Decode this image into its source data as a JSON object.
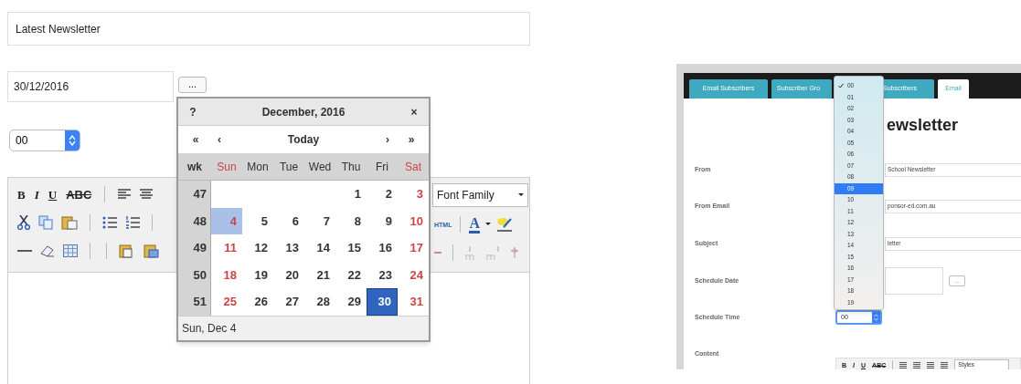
{
  "editor_form": {
    "title_field": {
      "value": "Latest Newsletter"
    },
    "date_field": {
      "value": "30/12/2016"
    },
    "date_button": "...",
    "time_select": {
      "value": "00"
    },
    "toolbar": {
      "format_buttons": [
        "B",
        "I",
        "U",
        "ABC"
      ],
      "font_family": "Font Family",
      "html_button": "HTML",
      "font_color_button": "A"
    }
  },
  "calendar": {
    "help": "?",
    "title": "December, 2016",
    "close": "×",
    "nav": [
      "«",
      "‹",
      "Today",
      "›",
      "»"
    ],
    "week_header": "wk",
    "weekdays": [
      {
        "label": "Sun",
        "weekend": true
      },
      {
        "label": "Mon",
        "weekend": false
      },
      {
        "label": "Tue",
        "weekend": false
      },
      {
        "label": "Wed",
        "weekend": false
      },
      {
        "label": "Thu",
        "weekend": false
      },
      {
        "label": "Fri",
        "weekend": false
      },
      {
        "label": "Sat",
        "weekend": true
      }
    ],
    "weeks": [
      {
        "number": "47",
        "days": [
          {
            "label": "1",
            "weekend": false,
            "selected": false,
            "hovered": false
          },
          {
            "label": "2",
            "weekend": false,
            "selected": false,
            "hovered": false
          },
          {
            "label": "3",
            "weekend": true,
            "selected": false,
            "hovered": false
          }
        ]
      },
      {
        "number": "48",
        "days": [
          {
            "label": "4",
            "weekend": true,
            "selected": false,
            "hovered": true
          },
          {
            "label": "5",
            "weekend": false,
            "selected": false,
            "hovered": false
          },
          {
            "label": "6",
            "weekend": false,
            "selected": false,
            "hovered": false
          },
          {
            "label": "7",
            "weekend": false,
            "selected": false,
            "hovered": false
          },
          {
            "label": "8",
            "weekend": false,
            "selected": false,
            "hovered": false
          },
          {
            "label": "9",
            "weekend": false,
            "selected": false,
            "hovered": false
          },
          {
            "label": "10",
            "weekend": true,
            "selected": false,
            "hovered": false
          }
        ]
      },
      {
        "number": "49",
        "days": [
          {
            "label": "11",
            "weekend": true,
            "selected": false,
            "hovered": false
          },
          {
            "label": "12",
            "weekend": false,
            "selected": false,
            "hovered": false
          },
          {
            "label": "13",
            "weekend": false,
            "selected": false,
            "hovered": false
          },
          {
            "label": "14",
            "weekend": false,
            "selected": false,
            "hovered": false
          },
          {
            "label": "15",
            "weekend": false,
            "selected": false,
            "hovered": false
          },
          {
            "label": "16",
            "weekend": false,
            "selected": false,
            "hovered": false
          },
          {
            "label": "17",
            "weekend": true,
            "selected": false,
            "hovered": false
          }
        ]
      },
      {
        "number": "50",
        "days": [
          {
            "label": "18",
            "weekend": true,
            "selected": false,
            "hovered": false
          },
          {
            "label": "19",
            "weekend": false,
            "selected": false,
            "hovered": false
          },
          {
            "label": "20",
            "weekend": false,
            "selected": false,
            "hovered": false
          },
          {
            "label": "21",
            "weekend": false,
            "selected": false,
            "hovered": false
          },
          {
            "label": "22",
            "weekend": false,
            "selected": false,
            "hovered": false
          },
          {
            "label": "23",
            "weekend": false,
            "selected": false,
            "hovered": false
          },
          {
            "label": "24",
            "weekend": true,
            "selected": false,
            "hovered": false
          }
        ]
      },
      {
        "number": "51",
        "days": [
          {
            "label": "25",
            "weekend": true,
            "selected": false,
            "hovered": false
          },
          {
            "label": "26",
            "weekend": false,
            "selected": false,
            "hovered": false
          },
          {
            "label": "27",
            "weekend": false,
            "selected": false,
            "hovered": false
          },
          {
            "label": "28",
            "weekend": false,
            "selected": false,
            "hovered": false
          },
          {
            "label": "29",
            "weekend": false,
            "selected": false,
            "hovered": false
          },
          {
            "label": "30",
            "weekend": false,
            "selected": true,
            "hovered": false
          },
          {
            "label": "31",
            "weekend": true,
            "selected": false,
            "hovered": false
          }
        ]
      }
    ],
    "status": "Sun, Dec 4"
  },
  "preview": {
    "tabs": [
      {
        "label": "Email Subscribers",
        "selected": false
      },
      {
        "label": "Subscriber Gro",
        "selected": false
      },
      {
        "label": "Subscribers",
        "selected": false
      },
      {
        "label": "Email",
        "selected": true
      }
    ],
    "heading": "ewsletter",
    "rows": [
      {
        "label": "From",
        "kind": "text",
        "value": "School Newsletter"
      },
      {
        "label": "From Email",
        "kind": "text",
        "value": "ponsor-ed.com.au"
      },
      {
        "label": "Subject",
        "kind": "text",
        "value": "letter"
      },
      {
        "label": "Schedule Date",
        "kind": "date",
        "button": "..."
      },
      {
        "label": "Schedule Time",
        "kind": "select",
        "value": "00"
      },
      {
        "label": "Content",
        "kind": "editor",
        "format_buttons": [
          "B",
          "I",
          "U",
          "ABC"
        ],
        "styles": "Styles"
      }
    ],
    "time_options": [
      {
        "label": "00",
        "checked": true,
        "highlighted": false
      },
      {
        "label": "01",
        "checked": false,
        "highlighted": false
      },
      {
        "label": "02",
        "checked": false,
        "highlighted": false
      },
      {
        "label": "03",
        "checked": false,
        "highlighted": false
      },
      {
        "label": "04",
        "checked": false,
        "highlighted": false
      },
      {
        "label": "05",
        "checked": false,
        "highlighted": false
      },
      {
        "label": "06",
        "checked": false,
        "highlighted": false
      },
      {
        "label": "07",
        "checked": false,
        "highlighted": false
      },
      {
        "label": "08",
        "checked": false,
        "highlighted": false
      },
      {
        "label": "09",
        "checked": false,
        "highlighted": true
      },
      {
        "label": "10",
        "checked": false,
        "highlighted": false
      },
      {
        "label": "11",
        "checked": false,
        "highlighted": false
      },
      {
        "label": "12",
        "checked": false,
        "highlighted": false
      },
      {
        "label": "13",
        "checked": false,
        "highlighted": false
      },
      {
        "label": "14",
        "checked": false,
        "highlighted": false
      },
      {
        "label": "15",
        "checked": false,
        "highlighted": false
      },
      {
        "label": "16",
        "checked": false,
        "highlighted": false
      },
      {
        "label": "17",
        "checked": false,
        "highlighted": false
      },
      {
        "label": "18",
        "checked": false,
        "highlighted": false
      },
      {
        "label": "19",
        "checked": false,
        "highlighted": false
      }
    ]
  }
}
